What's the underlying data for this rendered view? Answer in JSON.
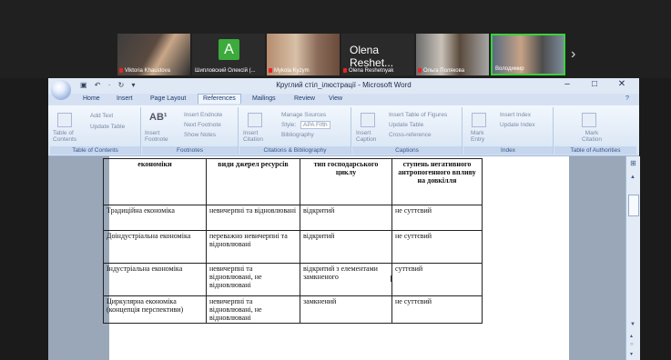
{
  "participants": [
    {
      "name": "Viktoria Khaustova"
    },
    {
      "name": "Шипловский Олексій (...",
      "initial": "A"
    },
    {
      "name": "Mykola Kyzym"
    },
    {
      "name": "Olena Reshetnyak",
      "big_name": "Olena Reshet..."
    },
    {
      "name": "Ольга Полякова"
    },
    {
      "name": "Володимир"
    }
  ],
  "word": {
    "title": "Круглий стіл_ілюстрації - Microsoft Word",
    "tabs": [
      "Home",
      "Insert",
      "Page Layout",
      "References",
      "Mailings",
      "Review",
      "View"
    ],
    "active_tab": "References",
    "groups": {
      "toc": {
        "label": "Table of Contents",
        "big": "Table of Contents",
        "items": [
          "Add Text",
          "Update Table"
        ]
      },
      "footnotes": {
        "label": "Footnotes",
        "big": "Insert Footnote",
        "items": [
          "Insert Endnote",
          "Next Footnote",
          "Show Notes"
        ]
      },
      "citations": {
        "label": "Citations & Bibliography",
        "big": "Insert Citation",
        "items": [
          "Manage Sources",
          "Style:",
          "APA Fifth",
          "Bibliography"
        ]
      },
      "captions": {
        "label": "Captions",
        "big": "Insert Caption",
        "items": [
          "Insert Table of Figures",
          "Update Table",
          "Cross-reference"
        ]
      },
      "index": {
        "label": "Index",
        "big": "Mark Entry",
        "items": [
          "Insert Index",
          "Update Index"
        ]
      },
      "toa": {
        "label": "Table of Authorities",
        "big": "Mark Citation"
      }
    }
  },
  "table": {
    "headers": [
      "економіки",
      "види джерел ресурсів",
      "тип господарського циклу",
      "ступень негативного антропогенного впливу на довкілля"
    ],
    "rows": [
      [
        "Традиційна економіка",
        "невичерпні та відновлювані",
        "відкритий",
        "не суттєвий"
      ],
      [
        "Доіндустріальна економіка",
        "переважно невичерпні та відновлювані",
        "відкритий",
        "не суттєвий"
      ],
      [
        "Індустріальна економіка",
        "невичерпні та відновлювані, не відновлювані",
        "відкритий з елементами замкненого",
        "суттєвий"
      ],
      [
        "Циркулярна економіка (концепція перспективи)",
        "невичерпні та відновлювані, не відновлювані",
        "замкнений",
        "не суттєвий"
      ]
    ]
  },
  "colors": {
    "accent": "#2b579a",
    "ribbon": "#dfe8f5"
  }
}
